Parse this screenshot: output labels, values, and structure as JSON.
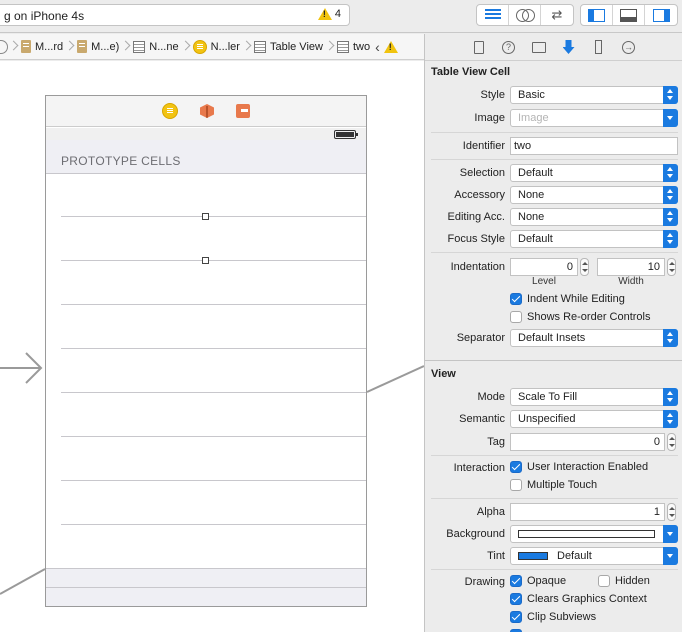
{
  "toolbar": {
    "activity_title": "g on iPhone 4s",
    "warning_count": "4"
  },
  "jumpbar": {
    "crumbs": [
      "M...rd",
      "M...e)",
      "N...ne",
      "N...ler",
      "Table View",
      "two"
    ]
  },
  "canvas": {
    "section_header": "PROTOTYPE CELLS"
  },
  "inspector": {
    "table_view_cell": {
      "title": "Table View Cell",
      "style_label": "Style",
      "style_value": "Basic",
      "image_label": "Image",
      "image_placeholder": "Image",
      "identifier_label": "Identifier",
      "identifier_value": "two",
      "selection_label": "Selection",
      "selection_value": "Default",
      "accessory_label": "Accessory",
      "accessory_value": "None",
      "editing_acc_label": "Editing Acc.",
      "editing_acc_value": "None",
      "focus_style_label": "Focus Style",
      "focus_style_value": "Default",
      "indentation_label": "Indentation",
      "indentation_level": "0",
      "level_label": "Level",
      "indentation_width": "10",
      "width_label": "Width",
      "indent_while_editing": "Indent While Editing",
      "shows_reorder": "Shows Re-order Controls",
      "separator_label": "Separator",
      "separator_value": "Default Insets"
    },
    "view": {
      "title": "View",
      "mode_label": "Mode",
      "mode_value": "Scale To Fill",
      "semantic_label": "Semantic",
      "semantic_value": "Unspecified",
      "tag_label": "Tag",
      "tag_value": "0",
      "interaction_label": "Interaction",
      "user_interaction_enabled": "User Interaction Enabled",
      "multiple_touch": "Multiple Touch",
      "alpha_label": "Alpha",
      "alpha_value": "1",
      "background_label": "Background",
      "tint_label": "Tint",
      "tint_value": "Default",
      "drawing_label": "Drawing",
      "opaque": "Opaque",
      "hidden": "Hidden",
      "clears_graphics_context": "Clears Graphics Context",
      "clip_subviews": "Clip Subviews"
    }
  },
  "colors": {
    "accent": "#1a7ae0",
    "tint_swatch": "#1a7ae0",
    "background_swatch": "#ffffff",
    "warning": "#f1c40f"
  }
}
